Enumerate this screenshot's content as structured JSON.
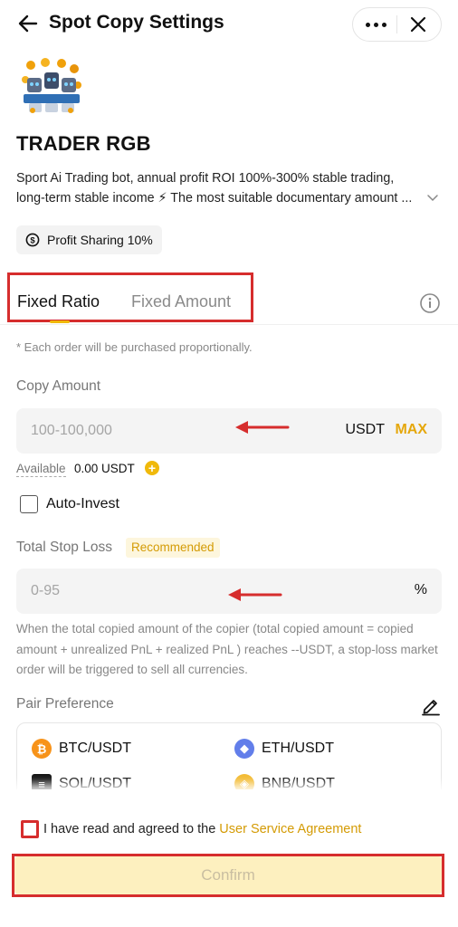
{
  "header": {
    "title": "Spot Copy Settings"
  },
  "trader": {
    "name": "TRADER RGB",
    "description": "Sport Ai Trading bot, annual profit ROI 100%-300% stable trading, long-term stable income ⚡ The most suitable documentary amount ...",
    "profit_sharing": "Profit Sharing 10%"
  },
  "tabs": [
    {
      "label": "Fixed Ratio",
      "active": true
    },
    {
      "label": "Fixed Amount",
      "active": false
    }
  ],
  "note": "* Each order will be purchased proportionally.",
  "copy_amount": {
    "label": "Copy Amount",
    "placeholder": "100-100,000",
    "unit": "USDT",
    "max_label": "MAX",
    "available_label": "Available",
    "available_value": "0.00 USDT"
  },
  "auto_invest": {
    "label": "Auto-Invest",
    "checked": false
  },
  "stop_loss": {
    "label": "Total Stop Loss",
    "badge": "Recommended",
    "placeholder": "0-95",
    "unit": "%",
    "description": "When the total copied amount of the copier (total copied amount = copied amount + unrealized PnL + realized PnL ) reaches --USDT, a stop-loss market order will be triggered to sell all currencies."
  },
  "pair_preference": {
    "label": "Pair Preference",
    "pairs": [
      {
        "name": "BTC/USDT",
        "icon": "btc-icon"
      },
      {
        "name": "ETH/USDT",
        "icon": "eth-icon"
      },
      {
        "name": "SOL/USDT",
        "icon": "sol-icon"
      },
      {
        "name": "BNB/USDT",
        "icon": "bnb-icon"
      }
    ]
  },
  "agreement": {
    "text": "I have read and agreed to the ",
    "link": "User Service Agreement",
    "checked": false
  },
  "confirm_label": "Confirm",
  "colors": {
    "accent": "#f0b90b",
    "annotation_red": "#d62d2d",
    "confirm_bg": "#fdf0bf"
  }
}
